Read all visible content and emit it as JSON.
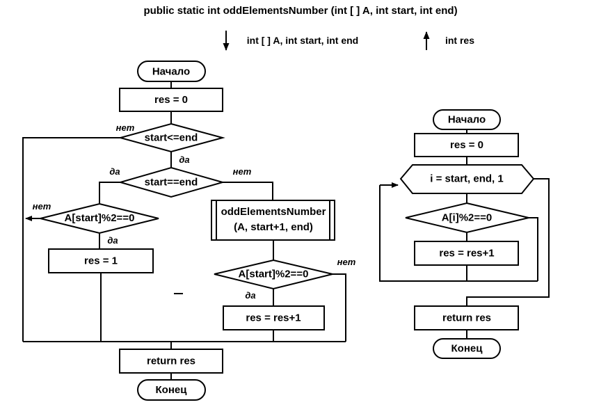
{
  "diagram": {
    "title": "public static int oddElementsNumber (int [ ] A, int start, int end)",
    "input_label": "int [ ] A, int start, int end",
    "output_label": "int res",
    "separator_dash": "–"
  },
  "labels": {
    "yes": "да",
    "no": "нет"
  },
  "recursive_chart": {
    "name": "recursive-version",
    "nodes": {
      "start": "Начало",
      "init_res": "res = 0",
      "cond_range": "start<=end",
      "cond_equal": "start==end",
      "cond_even_left": "A[start]%2==0",
      "assign_res1": "res = 1",
      "call_line1": "oddElementsNumber",
      "call_line2": "(A,  start+1,  end)",
      "cond_even_right": "A[start]%2==0",
      "incr_res": "res = res+1",
      "return": "return res",
      "end": "Конец"
    },
    "edge_labels": {
      "range_no": "нет",
      "range_yes": "да",
      "equal_yes": "да",
      "equal_no": "нет",
      "even_left_no": "нет",
      "even_left_yes": "да",
      "even_right_no": "нет",
      "even_right_yes": "да"
    }
  },
  "iterative_chart": {
    "name": "iterative-version",
    "nodes": {
      "start": "Начало",
      "init_res": "res = 0",
      "loop": "i = start, end, 1",
      "cond_even": "A[i]%2==0",
      "incr_res": "res = res+1",
      "return": "return res",
      "end": "Конец"
    }
  },
  "colors": {
    "stroke": "#000000",
    "fill": "#ffffff",
    "text": "#000000"
  }
}
